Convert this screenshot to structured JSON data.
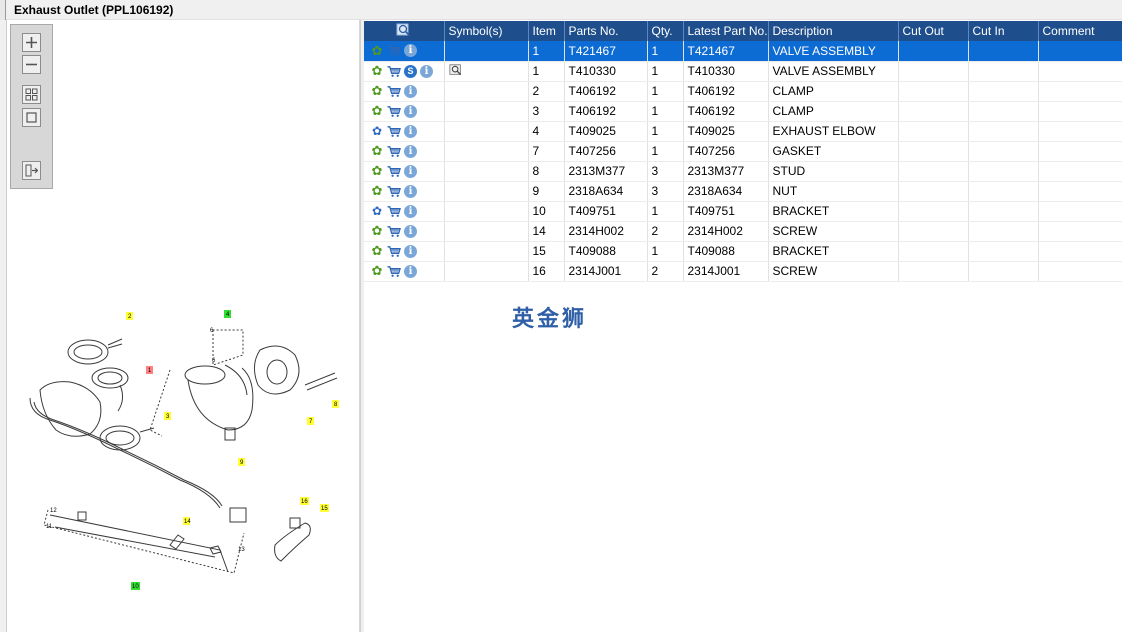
{
  "window": {
    "title": "Exhaust Outlet (PPL106192)"
  },
  "toolbar": {
    "buttons": [
      "zoom-in",
      "zoom-out",
      "fit-all",
      "fit-window",
      "export"
    ]
  },
  "drawing": {
    "callouts": [
      "2",
      "1",
      "4",
      "6",
      "3",
      "6",
      "7",
      "8",
      "9",
      "12",
      "11",
      "14",
      "13",
      "10",
      "16",
      "15"
    ]
  },
  "table": {
    "columns": [
      "",
      "Symbol(s)",
      "Item",
      "Parts No.",
      "Qty.",
      "Latest Part No.",
      "Description",
      "Cut Out",
      "Cut In",
      "Comment"
    ],
    "rows": [
      {
        "selected": true,
        "gear": "green",
        "badge_s": false,
        "symbol": false,
        "item": "1",
        "part": "T421467",
        "qty": "1",
        "latest": "T421467",
        "desc": "VALVE ASSEMBLY"
      },
      {
        "selected": false,
        "gear": "green",
        "badge_s": true,
        "symbol": true,
        "item": "1",
        "part": "T410330",
        "qty": "1",
        "latest": "T410330",
        "desc": "VALVE ASSEMBLY"
      },
      {
        "selected": false,
        "gear": "green",
        "badge_s": false,
        "symbol": false,
        "item": "2",
        "part": "T406192",
        "qty": "1",
        "latest": "T406192",
        "desc": "CLAMP"
      },
      {
        "selected": false,
        "gear": "green",
        "badge_s": false,
        "symbol": false,
        "item": "3",
        "part": "T406192",
        "qty": "1",
        "latest": "T406192",
        "desc": "CLAMP"
      },
      {
        "selected": false,
        "gear": "blue",
        "badge_s": false,
        "symbol": false,
        "item": "4",
        "part": "T409025",
        "qty": "1",
        "latest": "T409025",
        "desc": "EXHAUST ELBOW"
      },
      {
        "selected": false,
        "gear": "green",
        "badge_s": false,
        "symbol": false,
        "item": "7",
        "part": "T407256",
        "qty": "1",
        "latest": "T407256",
        "desc": "GASKET"
      },
      {
        "selected": false,
        "gear": "green",
        "badge_s": false,
        "symbol": false,
        "item": "8",
        "part": "2313M377",
        "qty": "3",
        "latest": "2313M377",
        "desc": "STUD"
      },
      {
        "selected": false,
        "gear": "green",
        "badge_s": false,
        "symbol": false,
        "item": "9",
        "part": "2318A634",
        "qty": "3",
        "latest": "2318A634",
        "desc": "NUT"
      },
      {
        "selected": false,
        "gear": "blue",
        "badge_s": false,
        "symbol": false,
        "item": "10",
        "part": "T409751",
        "qty": "1",
        "latest": "T409751",
        "desc": "BRACKET"
      },
      {
        "selected": false,
        "gear": "green",
        "badge_s": false,
        "symbol": false,
        "item": "14",
        "part": "2314H002",
        "qty": "2",
        "latest": "2314H002",
        "desc": "SCREW"
      },
      {
        "selected": false,
        "gear": "green",
        "badge_s": false,
        "symbol": false,
        "item": "15",
        "part": "T409088",
        "qty": "1",
        "latest": "T409088",
        "desc": "BRACKET"
      },
      {
        "selected": false,
        "gear": "green",
        "badge_s": false,
        "symbol": false,
        "item": "16",
        "part": "2314J001",
        "qty": "2",
        "latest": "2314J001",
        "desc": "SCREW"
      }
    ]
  },
  "watermark": "英金狮",
  "colors": {
    "header": "#1f4e8c",
    "selected": "#0d6bd4",
    "gear_green": "#4f9a1f",
    "gear_blue": "#2e67c6"
  }
}
